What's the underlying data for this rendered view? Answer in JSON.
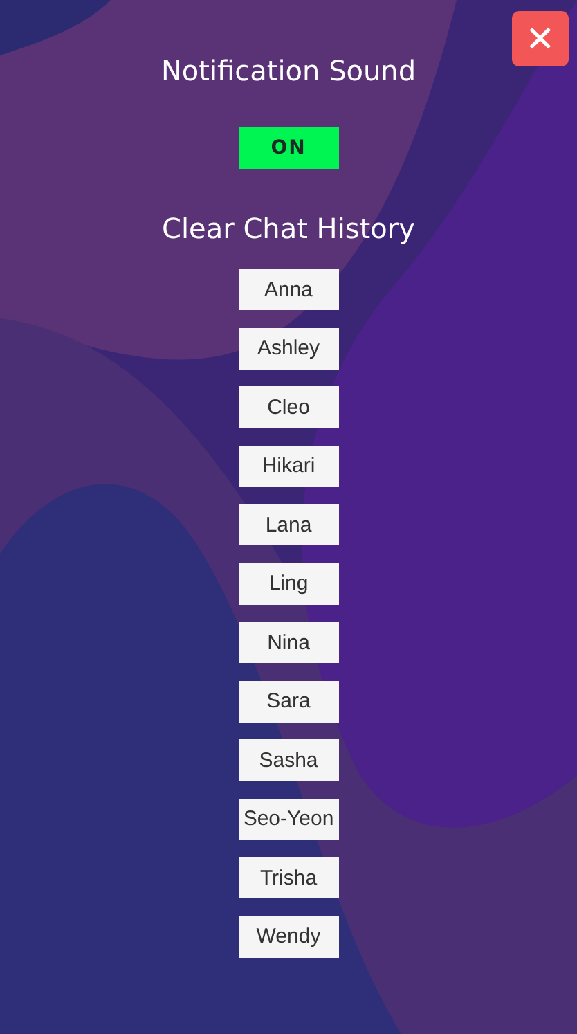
{
  "close_button": {
    "label": "✕"
  },
  "notification_sound": {
    "title": "Notification Sound",
    "toggle": {
      "text": "ON",
      "on": true
    }
  },
  "clear_chat_history": {
    "title": "Clear Chat History",
    "contacts": [
      {
        "name": "Anna"
      },
      {
        "name": "Ashley"
      },
      {
        "name": "Cleo"
      },
      {
        "name": "Hikari"
      },
      {
        "name": "Lana"
      },
      {
        "name": "Ling"
      },
      {
        "name": "Nina"
      },
      {
        "name": "Sara"
      },
      {
        "name": "Sasha"
      },
      {
        "name": "Seo-Yeon"
      },
      {
        "name": "Trisha"
      },
      {
        "name": "Wendy"
      }
    ]
  }
}
